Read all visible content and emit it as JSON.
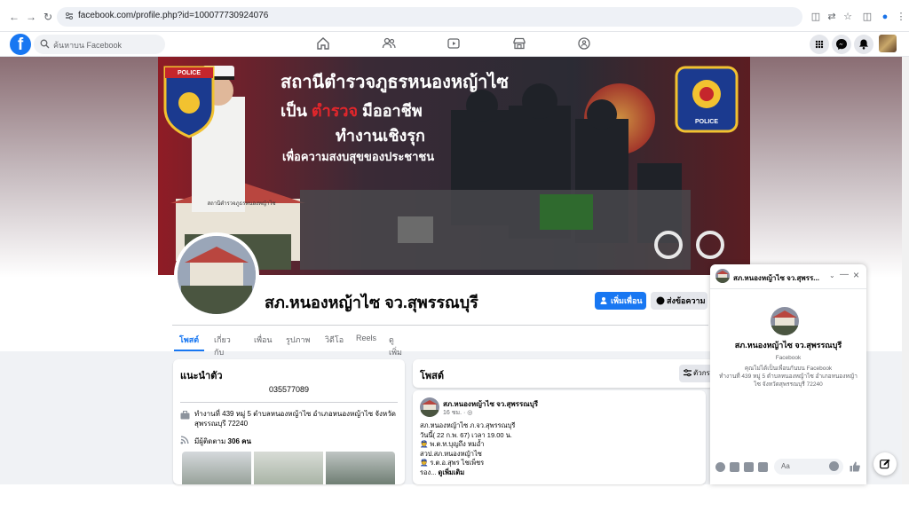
{
  "browser": {
    "url": "facebook.com/profile.php?id=100077730924076"
  },
  "header": {
    "search_placeholder": "ค้นหาบน Facebook"
  },
  "cover": {
    "headline": "สถานีตำรวจภูธรหนองหญ้าไซ",
    "line2_prefix": "เป็น",
    "line2_highlight": "ตำรวจ",
    "line2_suffix": "มืออาชีพ",
    "line3": "ทำงานเชิงรุก",
    "line4": "เพื่อความสงบสุขของประชาชน",
    "badge_text": "POLICE",
    "right_badge_text": "POLICE",
    "building_sign": "สถานีตำรวจภูธรหนองหญ้าไซ"
  },
  "profile": {
    "name": "สภ.หนองหญ้าไซ จว.สุพรรณบุรี",
    "add_friend": "เพิ่มเพื่อน",
    "message": "ส่งข้อความ"
  },
  "tabs": [
    "โพสต์",
    "เกี่ยวกับ",
    "เพื่อน",
    "รูปภาพ",
    "วิดีโอ",
    "Reels",
    "ดูเพิ่มเติม"
  ],
  "intro": {
    "title": "แนะนำตัว",
    "phone": "035577089",
    "address": "ทำงานที่ 439 หมู่ 5 ตำบลหนองหญ้าไซ อำเภอหนองหญ้าไซ จังหวัดสุพรรณบุรี 72240",
    "followers_prefix": "มีผู้ติดตาม",
    "followers_count": "306 คน"
  },
  "posts": {
    "title": "โพสต์",
    "filter": "ตัวกร",
    "author": "สภ.หนองหญ้าไซ จว.สุพรรณบุรี",
    "time": "16 ชม. ·",
    "lines": [
      "สภ.หนองหญ้าไซ ภ.จว.สุพรรณบุรี",
      "วันนี้( 22 ก.พ. 67) เวลา 19.00 น.",
      "👮 พ.ต.ท.บุญถึง หมอ้ำ",
      "สวป.สภ.หนองหญ้าไซ",
      "👮 ร.ต.อ.สุพร ไชเพ็ชร"
    ],
    "more_prefix": "รอง...",
    "see_more": "ดูเพิ่มเติม"
  },
  "chat": {
    "header_name": "สภ.หนองหญ้าไซ จว.สุพรร...",
    "name": "สภ.หนองหญ้าไซ จว.สุพรรณบุรี",
    "subtitle": "Facebook",
    "not_friends": "คุณไม่ได้เป็นเพื่อนกันบน Facebook",
    "workplace": "ทำงานที่ 439 หมู่ 5 ตำบลหนองหญ้าไซ อำเภอหนองหญ้าไซ จังหวัดสุพรรณบุรี 72240",
    "input_placeholder": "Aa"
  },
  "colors": {
    "fb_blue": "#1877f2",
    "cover_red": "#e3262b",
    "cover_dark": "#2a2530"
  }
}
